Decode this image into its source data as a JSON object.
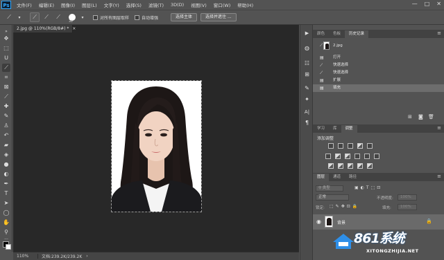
{
  "menubar": {
    "logo": "Ps",
    "items": [
      "文件(F)",
      "编辑(E)",
      "图像(I)",
      "图层(L)",
      "文字(Y)",
      "选择(S)",
      "滤镜(T)",
      "3D(D)",
      "视图(V)",
      "窗口(W)",
      "帮助(H)"
    ],
    "window_controls": [
      "—",
      "□",
      "✕"
    ]
  },
  "options": {
    "brush_size": "30",
    "sample_all_layers": "对所有图层取样",
    "auto_enhance": "自动增强",
    "select_subject": "选择主体",
    "select_and_mask": "选择并遮住 ..."
  },
  "document": {
    "tab_title": "2.jpg @ 110%(RGB/8#) *",
    "tab_close": "×"
  },
  "status": {
    "zoom": "110%",
    "doc_size": "文档:239.2K/239.2K"
  },
  "panel_top": {
    "tabs": [
      "颜色",
      "色板",
      "历史记录"
    ],
    "snapshot_name": "2.jpg",
    "history": [
      "打开",
      "快速选择",
      "快速选择",
      "扩展",
      "填充"
    ]
  },
  "panel_mid": {
    "tabs": [
      "学习",
      "库",
      "调整"
    ],
    "title": "添加调整"
  },
  "panel_layers": {
    "tabs": [
      "图层",
      "通道",
      "路径"
    ],
    "kind_placeholder": "类型",
    "blend_mode": "正常",
    "opacity_label": "不透明度:",
    "opacity": "100%",
    "lock_label": "锁定:",
    "fill_label": "填充:",
    "fill": "100%",
    "layer_name": "背景"
  },
  "watermark": {
    "brand": "861系统",
    "url": "XITONGZHIJIA.NET"
  },
  "colors": {
    "accent": "#31a8ff",
    "canvas": "#282828",
    "panel": "#535353"
  }
}
